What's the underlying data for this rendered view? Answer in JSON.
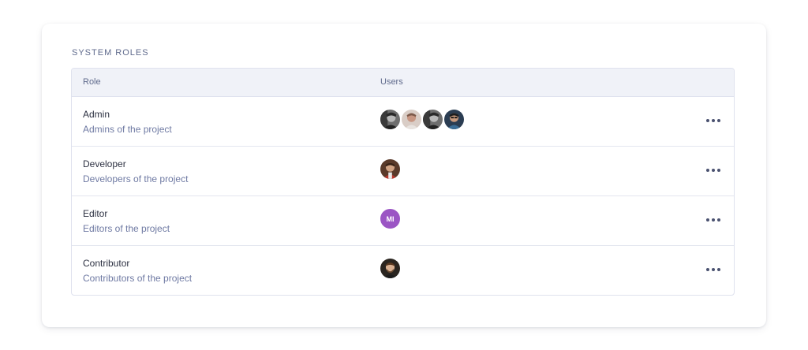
{
  "section": {
    "title": "SYSTEM ROLES"
  },
  "table": {
    "headers": {
      "role": "Role",
      "users": "Users"
    },
    "rows": [
      {
        "name": "Admin",
        "description": "Admins of the project",
        "users": [
          {
            "type": "photo",
            "icon": "user-photo-bw"
          },
          {
            "type": "photo",
            "icon": "user-photo-beige"
          },
          {
            "type": "photo",
            "icon": "user-photo-bw"
          },
          {
            "type": "photo",
            "icon": "user-photo-blue"
          }
        ]
      },
      {
        "name": "Developer",
        "description": "Developers of the project",
        "users": [
          {
            "type": "photo",
            "icon": "user-photo-red"
          }
        ]
      },
      {
        "name": "Editor",
        "description": "Editors of the project",
        "users": [
          {
            "type": "initials",
            "initials": "MI",
            "color": "#9b55c4"
          }
        ]
      },
      {
        "name": "Contributor",
        "description": "Contributors of the project",
        "users": [
          {
            "type": "photo",
            "icon": "user-photo-dark"
          }
        ]
      }
    ]
  },
  "colors": {
    "header_bg": "#f0f2f8",
    "border": "#dfe2ee",
    "muted_text": "#6f7aa3",
    "avatar_purple": "#9b55c4"
  }
}
